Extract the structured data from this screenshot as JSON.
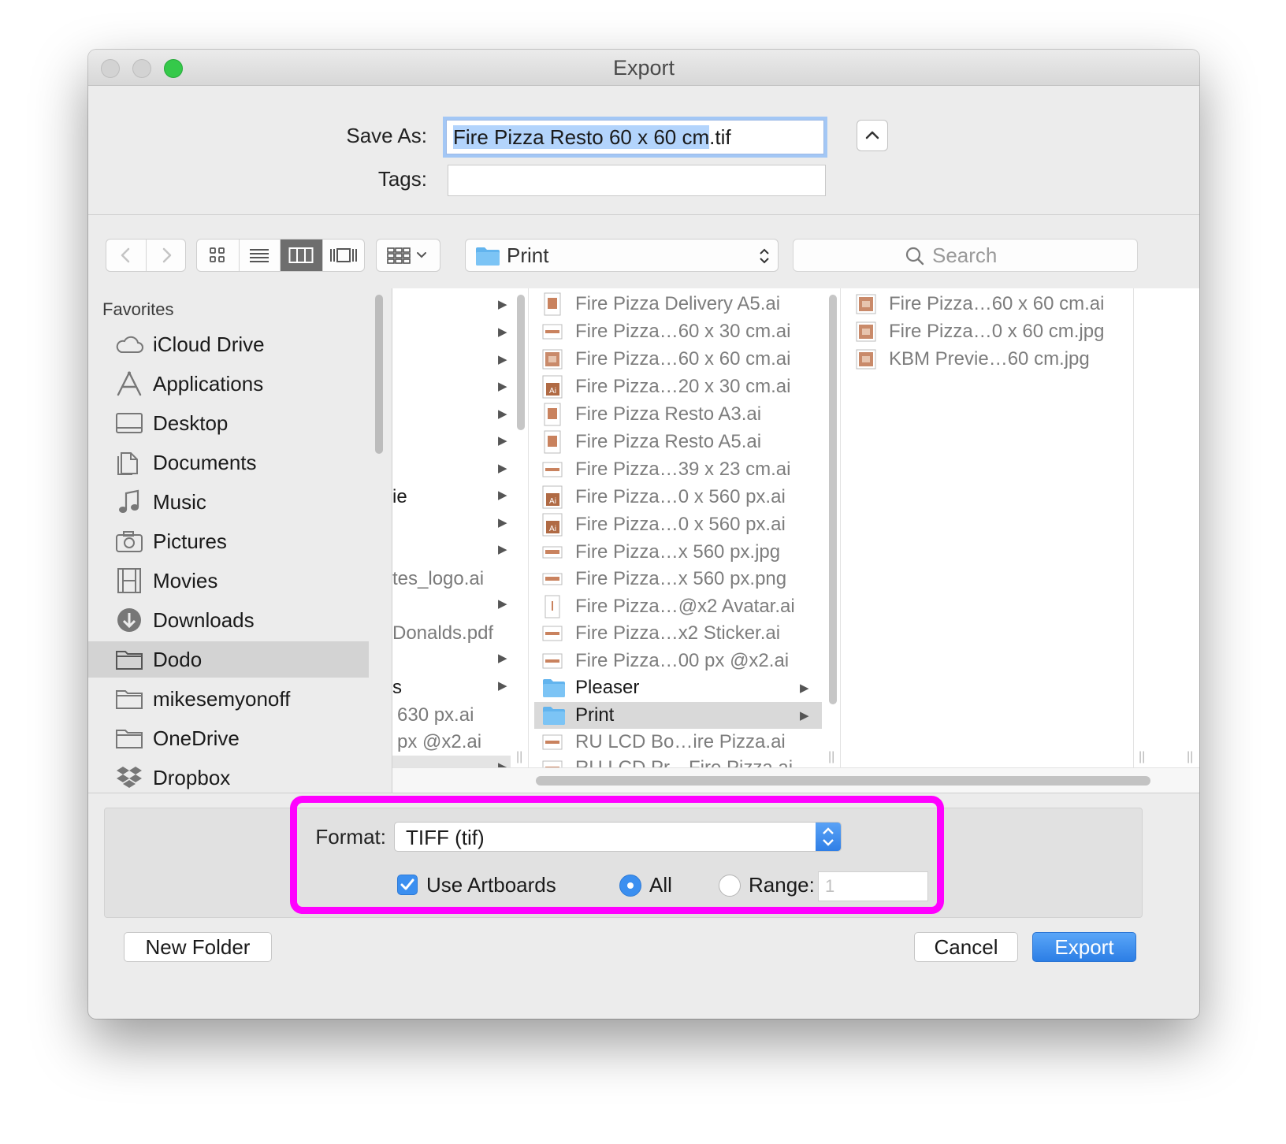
{
  "window": {
    "title": "Export"
  },
  "save": {
    "save_as_label": "Save As:",
    "filename_selected": "Fire Pizza Resto 60 x 60 cm",
    "filename_ext": ".tif",
    "tags_label": "Tags:",
    "tags_value": ""
  },
  "toolbar": {
    "location": "Print",
    "search_placeholder": "Search",
    "active_view": "columns"
  },
  "sidebar": {
    "heading": "Favorites",
    "items": [
      {
        "label": "iCloud Drive",
        "icon": "cloud-icon"
      },
      {
        "label": "Applications",
        "icon": "applications-icon"
      },
      {
        "label": "Desktop",
        "icon": "desktop-icon"
      },
      {
        "label": "Documents",
        "icon": "documents-icon"
      },
      {
        "label": "Music",
        "icon": "music-icon"
      },
      {
        "label": "Pictures",
        "icon": "camera-icon"
      },
      {
        "label": "Movies",
        "icon": "film-icon"
      },
      {
        "label": "Downloads",
        "icon": "download-icon"
      },
      {
        "label": "Dodo",
        "icon": "folder-icon",
        "selected": true
      },
      {
        "label": "mikesemyonoff",
        "icon": "folder-icon"
      },
      {
        "label": "OneDrive",
        "icon": "folder-icon"
      },
      {
        "label": "Dropbox",
        "icon": "dropbox-icon"
      }
    ]
  },
  "columns": {
    "col1": [
      {
        "text": "",
        "arrow": true
      },
      {
        "text": "",
        "arrow": true
      },
      {
        "text": "",
        "arrow": true
      },
      {
        "text": "",
        "arrow": true
      },
      {
        "text": "",
        "arrow": true
      },
      {
        "text": "",
        "arrow": true
      },
      {
        "text": "",
        "arrow": true
      },
      {
        "text": "ie",
        "arrow": true
      },
      {
        "text": "",
        "arrow": true
      },
      {
        "text": "",
        "arrow": true
      },
      {
        "text": "tes_logo.ai",
        "arrow": false
      },
      {
        "text": "",
        "arrow": true
      },
      {
        "text": "Donalds.pdf",
        "arrow": false
      },
      {
        "text": "",
        "arrow": true
      },
      {
        "text": "s",
        "arrow": true
      },
      {
        "text": "630 px.ai",
        "arrow": false
      },
      {
        "text": "px @x2.ai",
        "arrow": false
      },
      {
        "text": "",
        "arrow": true
      }
    ],
    "col2": [
      {
        "name": "Fire Pizza Delivery A5.ai",
        "type": "ai-doc"
      },
      {
        "name": "Fire Pizza…60 x 30 cm.ai",
        "type": "wide-doc"
      },
      {
        "name": "Fire Pizza…60 x 60 cm.ai",
        "type": "image-doc"
      },
      {
        "name": "Fire Pizza…20 x 30 cm.ai",
        "type": "ai-badge"
      },
      {
        "name": "Fire Pizza Resto A3.ai",
        "type": "ai-doc"
      },
      {
        "name": "Fire Pizza Resto A5.ai",
        "type": "ai-doc"
      },
      {
        "name": "Fire Pizza…39 x 23 cm.ai",
        "type": "wide-doc"
      },
      {
        "name": "Fire Pizza…0 x 560 px.ai",
        "type": "ai-badge"
      },
      {
        "name": "Fire Pizza…0 x 560 px.ai",
        "type": "ai-badge"
      },
      {
        "name": "Fire Pizza…x 560 px.jpg",
        "type": "wide-doc"
      },
      {
        "name": "Fire Pizza…x 560 px.png",
        "type": "wide-doc"
      },
      {
        "name": "Fire Pizza…@x2 Avatar.ai",
        "type": "tall-doc"
      },
      {
        "name": "Fire Pizza…x2 Sticker.ai",
        "type": "wide-doc"
      },
      {
        "name": "Fire Pizza…00 px @x2.ai",
        "type": "wide-doc"
      },
      {
        "name": "Pleaser",
        "type": "folder",
        "arrow": true
      },
      {
        "name": "Print",
        "type": "folder",
        "arrow": true,
        "selected": true
      },
      {
        "name": "RU LCD Bo…ire Pizza.ai",
        "type": "wide-doc"
      },
      {
        "name": "RU LCD Pr…Fire Pizza.ai",
        "type": "wide-doc"
      }
    ],
    "col3": [
      {
        "name": "Fire Pizza…60 x 60 cm.ai",
        "type": "image-doc"
      },
      {
        "name": "Fire Pizza…0 x 60 cm.jpg",
        "type": "image-doc"
      },
      {
        "name": "KBM Previe…60 cm.jpg",
        "type": "image-doc"
      }
    ]
  },
  "options": {
    "format_label": "Format:",
    "format_value": "TIFF (tif)",
    "use_artboards_label": "Use Artboards",
    "use_artboards_checked": true,
    "all_label": "All",
    "range_label": "Range:",
    "range_value": "1",
    "selected_range": "all"
  },
  "buttons": {
    "new_folder": "New Folder",
    "cancel": "Cancel",
    "export": "Export"
  },
  "colors": {
    "accent": "#3b8ff0",
    "highlight": "#ff00ff",
    "zoom": "#35c94a"
  }
}
